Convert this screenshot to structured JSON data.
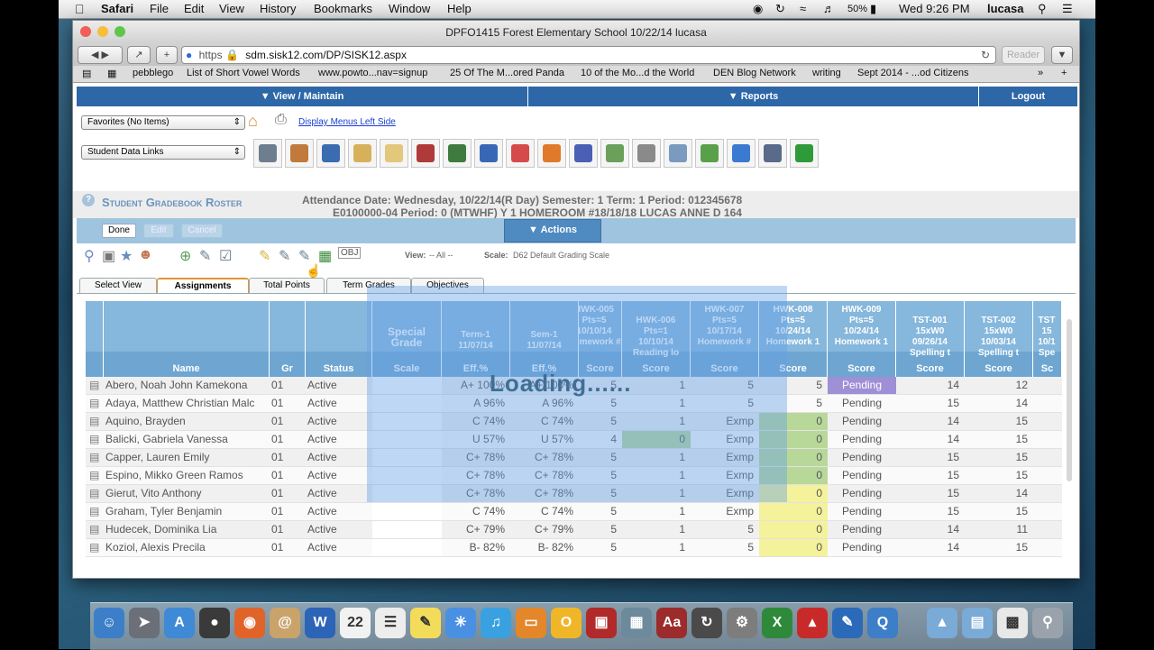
{
  "menubar": {
    "app_name": "Safari",
    "items": [
      "File",
      "Edit",
      "View",
      "History",
      "Bookmarks",
      "Window",
      "Help"
    ],
    "battery": "50%",
    "clock": "Wed 9:26 PM",
    "user": "lucasa"
  },
  "window": {
    "title": "DPFO1415 Forest Elementary School 10/22/14 lucasa",
    "url_scheme": "https",
    "url": "sdm.sisk12.com/DP/SISK12.aspx",
    "reader_label": "Reader",
    "bookmarks": [
      "pebblego",
      "List of Short Vowel Words",
      "www.powto...nav=signup",
      "25 Of The M...ored Panda",
      "10 of the Mo...d the World",
      "DEN Blog Network",
      "writing",
      "Sept 2014 - ...od Citizens"
    ]
  },
  "nav": {
    "view_maintain": "View / Maintain",
    "reports": "Reports",
    "logout": "Logout"
  },
  "favorites": {
    "select_value": "Favorites (No Items)",
    "display_menus_link": "Display Menus Left Side"
  },
  "student_links": {
    "select_value": "Student Data Links"
  },
  "section_title": "Student Gradebook Roster",
  "info": {
    "line1": "Attendance Date: Wednesday, 10/22/14(R Day)   Semester: 1   Term: 1   Period: 012345678",
    "line2": "E0100000-04   Period: 0 (MTWHF) Y 1 HOMEROOM #18/18/18 LUCAS ANNE D 164"
  },
  "buttons": {
    "done": "Done",
    "edit": "Edit",
    "cancel": "Cancel",
    "actions": "Actions"
  },
  "view_filter": {
    "view_label": "View:",
    "view_value": "-- All --",
    "scale_label": "Scale:",
    "scale_value": "D62 Default Grading Scale"
  },
  "tabs": [
    "Select View",
    "Assignments",
    "Total Points",
    "Term Grades",
    "Objectives"
  ],
  "loading_text": "Loading......",
  "grid": {
    "headers": {
      "name": "Name",
      "gr": "Gr",
      "status": "Status",
      "special": "Special Grade",
      "special_sub": "Scale",
      "term1": "Term-1 11/07/14",
      "term1_sub": "Eff.%",
      "sem1": "Sem-1 11/07/14",
      "sem1_sub": "Eff.%",
      "hwk005": "HWK-005 Pts=5 10/10/14 Homework #",
      "hwk005_sub": "Score",
      "hwk006": "HWK-006 Pts=1 10/10/14 Reading lo",
      "hwk006_sub": "Score",
      "hwk007": "HWK-007 Pts=5 10/17/14 Homework #",
      "hwk007_sub": "Score",
      "hwk008": "HWK-008 Pts=5 10/24/14 Homework 1",
      "hwk008_sub": "Score",
      "hwk009": "HWK-009 Pts=5 10/24/14 Homework 1",
      "hwk009_sub": "Score",
      "tst001": "TST-001 15xW0 09/26/14 Spelling t",
      "tst001_sub": "Score",
      "tst002": "TST-002 15xW0 10/03/14 Spelling t",
      "tst002_sub": "Score",
      "tst003": "TST 15 10/1 Spe",
      "tst003_sub": "Sc"
    },
    "rows": [
      {
        "name": "Abero, Noah John Kamekona",
        "gr": "01",
        "status": "Active",
        "term": "A+ 100%",
        "sem": "A+ 100%",
        "h5": "5",
        "h6": "1",
        "h7": "5",
        "h8": "5",
        "h9": "Pending",
        "t1": "14",
        "t2": "12"
      },
      {
        "name": "Adaya, Matthew Christian Malc",
        "gr": "01",
        "status": "Active",
        "term": "A 96%",
        "sem": "A 96%",
        "h5": "5",
        "h6": "1",
        "h7": "5",
        "h8": "5",
        "h9": "Pending",
        "t1": "15",
        "t2": "14"
      },
      {
        "name": "Aquino, Brayden",
        "gr": "01",
        "status": "Active",
        "term": "C 74%",
        "sem": "C 74%",
        "h5": "5",
        "h6": "1",
        "h7": "Exmp",
        "h8": "0",
        "h9": "Pending",
        "t1": "14",
        "t2": "15"
      },
      {
        "name": "Balicki, Gabriela Vanessa",
        "gr": "01",
        "status": "Active",
        "term": "U 57%",
        "sem": "U 57%",
        "h5": "4",
        "h6": "0",
        "h7": "Exmp",
        "h8": "0",
        "h9": "Pending",
        "t1": "14",
        "t2": "15"
      },
      {
        "name": "Capper, Lauren Emily",
        "gr": "01",
        "status": "Active",
        "term": "C+ 78%",
        "sem": "C+ 78%",
        "h5": "5",
        "h6": "1",
        "h7": "Exmp",
        "h8": "0",
        "h9": "Pending",
        "t1": "15",
        "t2": "15"
      },
      {
        "name": "Espino, Mikko Green Ramos",
        "gr": "01",
        "status": "Active",
        "term": "C+ 78%",
        "sem": "C+ 78%",
        "h5": "5",
        "h6": "1",
        "h7": "Exmp",
        "h8": "0",
        "h9": "Pending",
        "t1": "15",
        "t2": "15"
      },
      {
        "name": "Gierut, Vito Anthony",
        "gr": "01",
        "status": "Active",
        "term": "C+ 78%",
        "sem": "C+ 78%",
        "h5": "5",
        "h6": "1",
        "h7": "Exmp",
        "h8": "0",
        "h9": "Pending",
        "t1": "15",
        "t2": "14"
      },
      {
        "name": "Graham, Tyler Benjamin",
        "gr": "01",
        "status": "Active",
        "term": "C 74%",
        "sem": "C 74%",
        "h5": "5",
        "h6": "1",
        "h7": "Exmp",
        "h8": "0",
        "h9": "Pending",
        "t1": "15",
        "t2": "15"
      },
      {
        "name": "Hudecek, Dominika Lia",
        "gr": "01",
        "status": "Active",
        "term": "C+ 79%",
        "sem": "C+ 79%",
        "h5": "5",
        "h6": "1",
        "h7": "5",
        "h8": "0",
        "h9": "Pending",
        "t1": "14",
        "t2": "11"
      },
      {
        "name": "Koziol, Alexis Precila",
        "gr": "01",
        "status": "Active",
        "term": "B- 82%",
        "sem": "B- 82%",
        "h5": "5",
        "h6": "1",
        "h7": "5",
        "h8": "0",
        "h9": "Pending",
        "t1": "14",
        "t2": "15"
      }
    ]
  },
  "colors": {
    "nav_blue": "#2d67a7",
    "header_blue": "#86b7dc",
    "pending_purple": "#9f8fd6",
    "zero_yellow": "#f4f29a",
    "green_cell": "#b8d89a"
  }
}
